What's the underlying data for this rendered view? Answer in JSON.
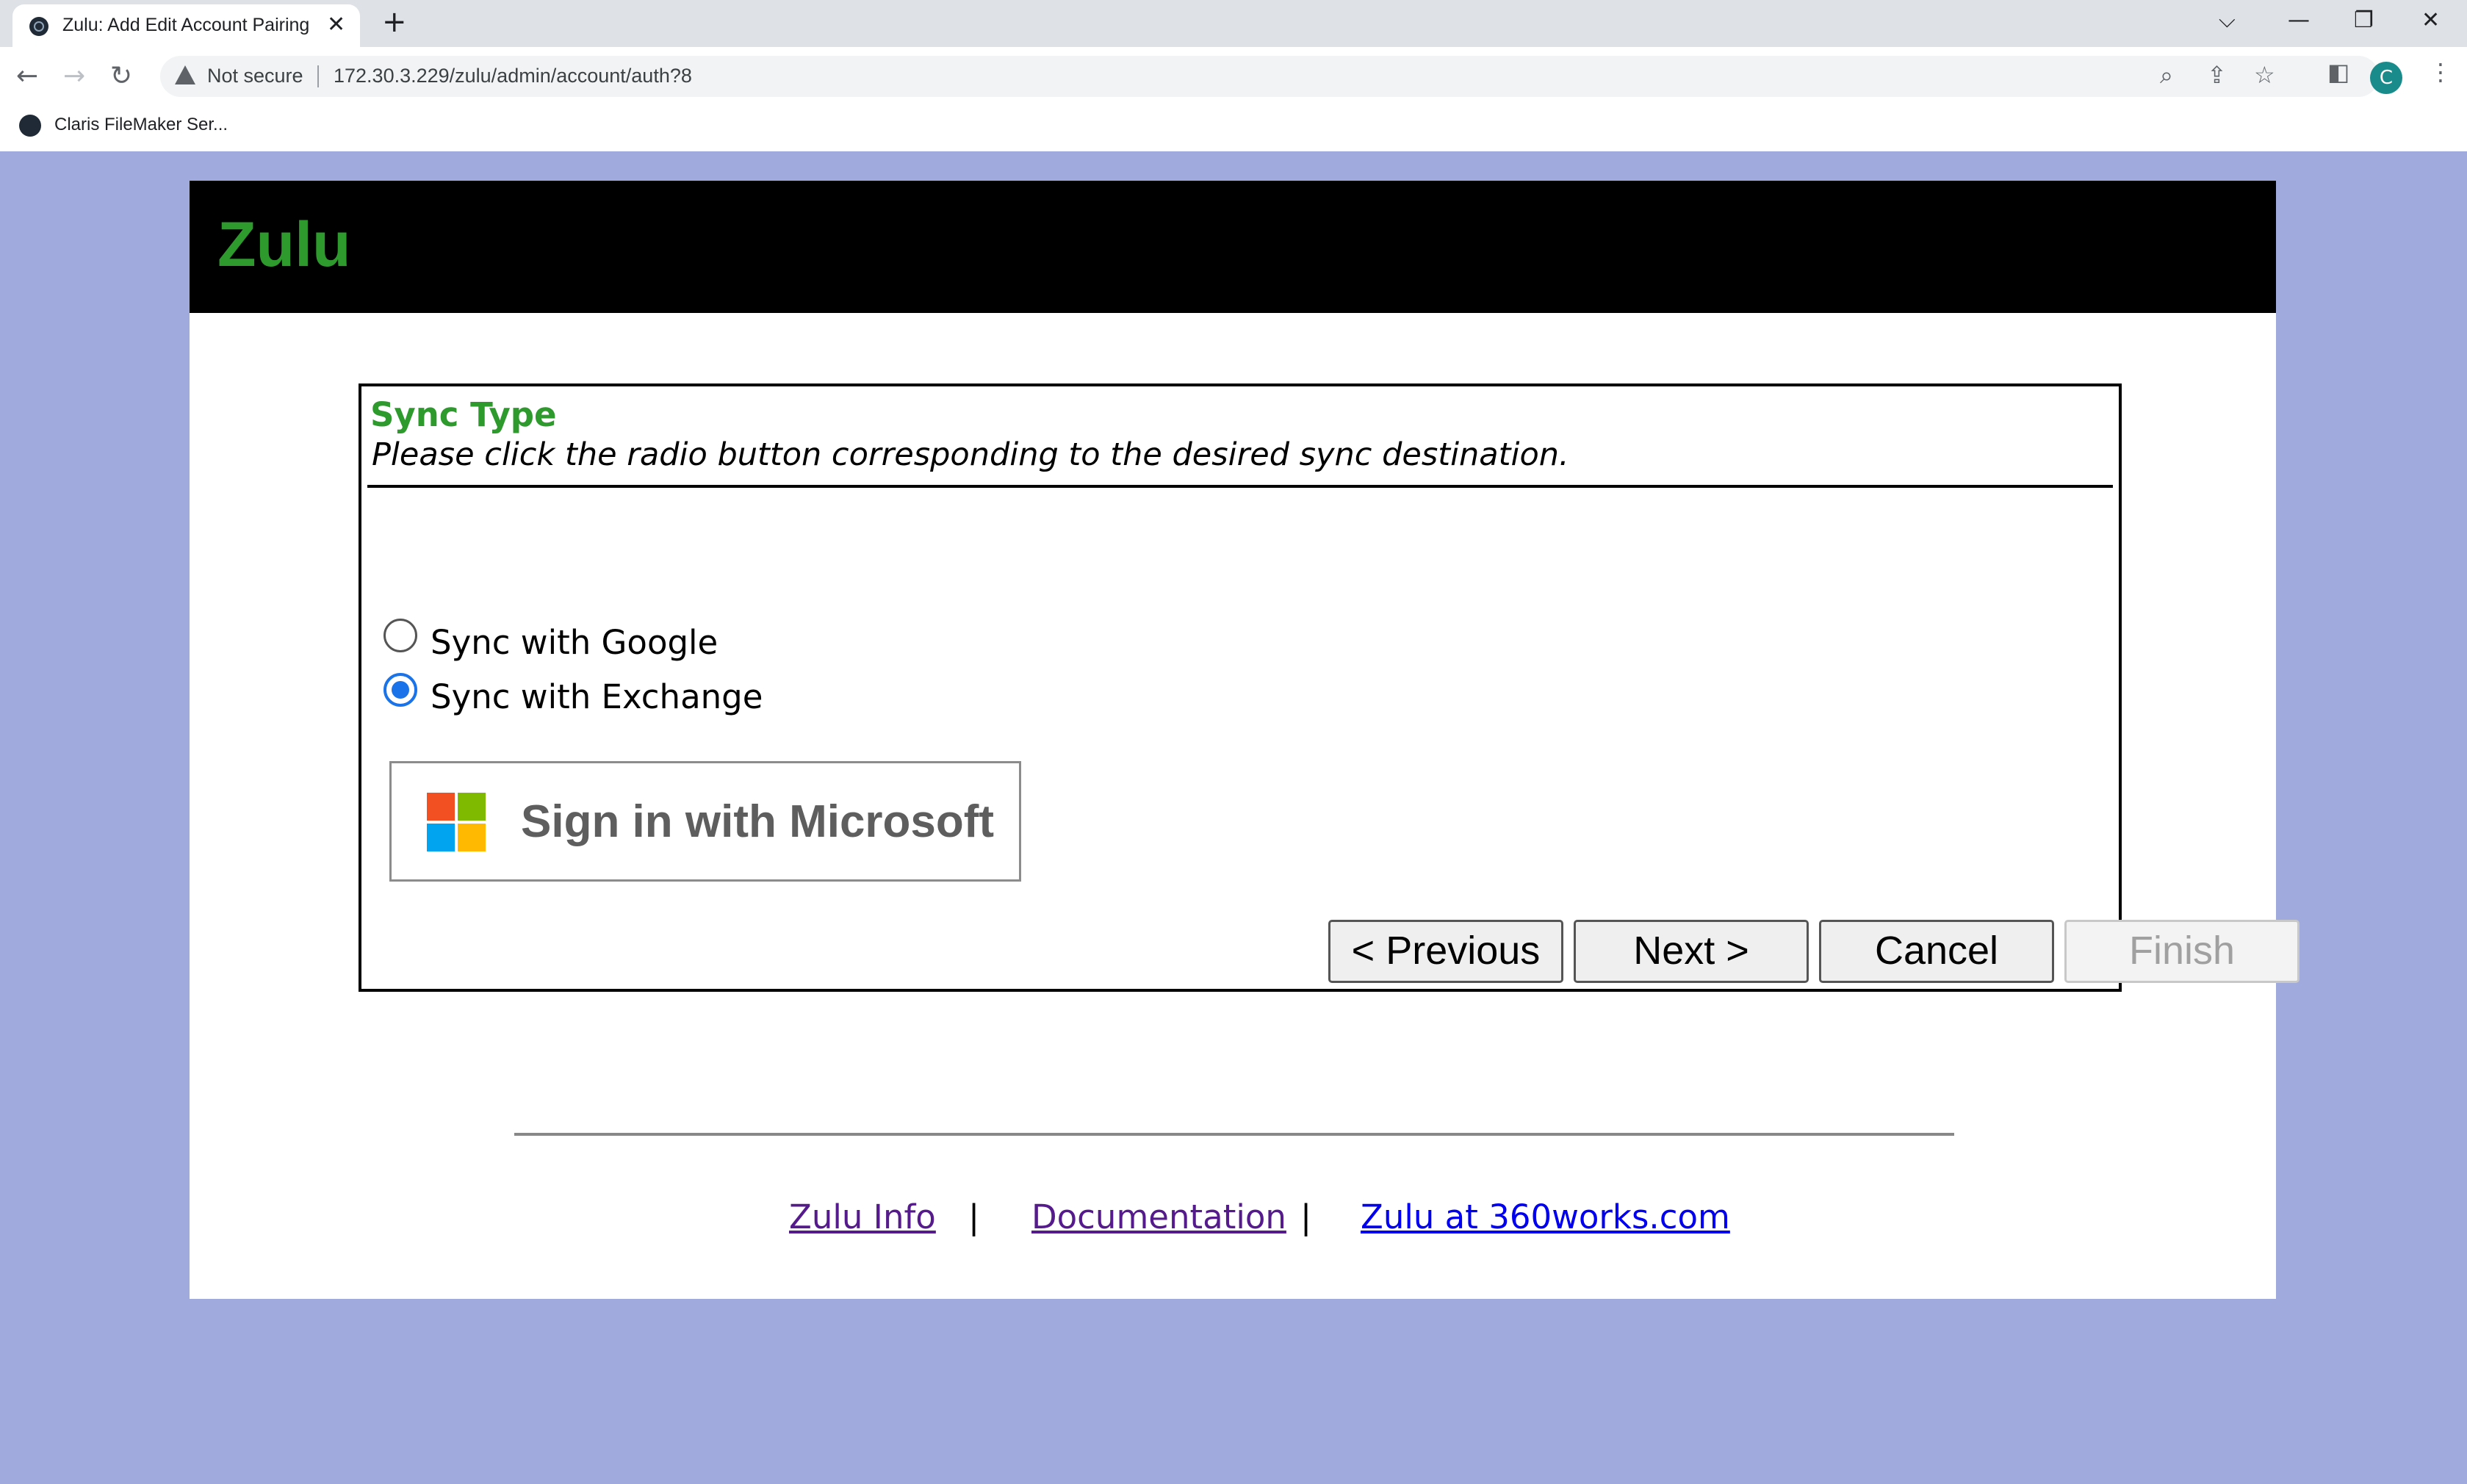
{
  "browser": {
    "tab_title": "Zulu: Add Edit Account Pairing",
    "tab_close": "✕",
    "new_tab": "+",
    "security_label": "Not secure",
    "url": "172.30.3.229/zulu/admin/account/auth?8",
    "profile_initial": "C",
    "bookmark_label": "Claris FileMaker Ser..."
  },
  "header": {
    "logo": "Zulu"
  },
  "panel": {
    "title": "Sync Type",
    "description": "Please click the radio button corresponding to the desired sync destination.",
    "options": [
      {
        "label": "Sync with Google",
        "selected": false
      },
      {
        "label": "Sync with Exchange",
        "selected": true
      }
    ],
    "ms_signin_label": "Sign in with Microsoft",
    "buttons": {
      "previous": "< Previous",
      "next": "Next >",
      "cancel": "Cancel",
      "finish": "Finish"
    }
  },
  "footer": {
    "links": [
      "Zulu Info",
      "Documentation",
      "Zulu at 360works.com"
    ],
    "separator": "|"
  },
  "colors": {
    "page_bg": "#a0aadd",
    "brand_green": "#2e9a2e",
    "visited_link": "#551a8b",
    "link": "#0000ee",
    "radio_accent": "#1a73e8"
  }
}
